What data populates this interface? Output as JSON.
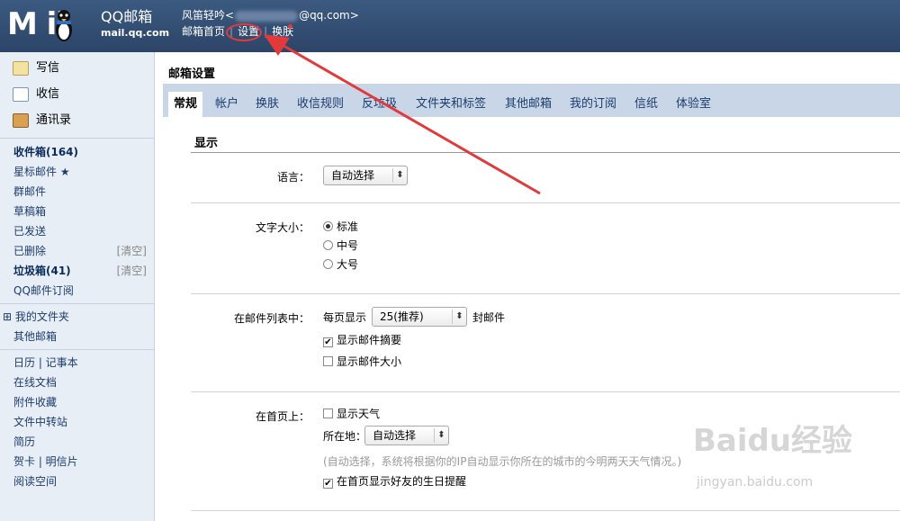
{
  "header": {
    "logo_mail": "M  il",
    "logo_qq": "QQ邮箱",
    "logo_url": "mail.qq.com",
    "user_name": "风笛轻吟<",
    "user_email_suffix": "@qq.com>",
    "nav": [
      "邮箱首页",
      "设置",
      "换肤"
    ],
    "nav_separator": "|"
  },
  "sidebar": {
    "compose": "写信",
    "inbox_check": "收信",
    "contacts": "通讯录",
    "folders": [
      {
        "label": "收件箱(164)",
        "bold": true
      },
      {
        "label": "星标邮件 ★",
        "bold": false
      },
      {
        "label": "群邮件",
        "bold": false
      },
      {
        "label": "草稿箱",
        "bold": false
      },
      {
        "label": "已发送",
        "bold": false
      },
      {
        "label": "已删除",
        "bold": false,
        "clear": "[清空]"
      },
      {
        "label": "垃圾箱(41)",
        "bold": true,
        "clear": "[清空]"
      },
      {
        "label": "QQ邮件订阅",
        "bold": false
      }
    ],
    "my_folders": "⊞ 我的文件夹",
    "other_mailbox": "其他邮箱",
    "tools": [
      "日历  |  记事本",
      "在线文档",
      "附件收藏",
      "文件中转站",
      "简历",
      "贺卡  |  明信片",
      "阅读空间"
    ]
  },
  "content": {
    "page_title": "邮箱设置",
    "tabs": [
      "常规",
      "帐户",
      "换肤",
      "收信规则",
      "反垃圾",
      "文件夹和标签",
      "其他邮箱",
      "我的订阅",
      "信纸",
      "体验室"
    ],
    "active_tab": "常规",
    "section_title": "显示",
    "language": {
      "label": "语言：",
      "value": "自动选择"
    },
    "font_size": {
      "label": "文字大小：",
      "options": [
        "标准",
        "中号",
        "大号"
      ],
      "selected": "标准"
    },
    "mail_list": {
      "label": "在邮件列表中：",
      "per_page_prefix": "每页显示",
      "per_page_value": "25(推荐)",
      "per_page_suffix": "封邮件",
      "show_summary": "显示邮件摘要",
      "show_size": "显示邮件大小"
    },
    "homepage": {
      "label": "在首页上：",
      "show_weather": "显示天气",
      "location_label": "所在地：",
      "location_value": "自动选择",
      "hint": "(自动选择，系统将根据你的IP自动显示你所在的城市的今明两天天气情况。)",
      "birthday": "在首页显示好友的生日提醒"
    }
  },
  "watermark": {
    "brand": "Baidu经验",
    "url": "jingyan.baidu.com"
  },
  "colors": {
    "header": "#2c4468",
    "sidebar": "#e8eef6",
    "tabbar": "#c8d6e8",
    "annotation": "#e23a3a"
  }
}
